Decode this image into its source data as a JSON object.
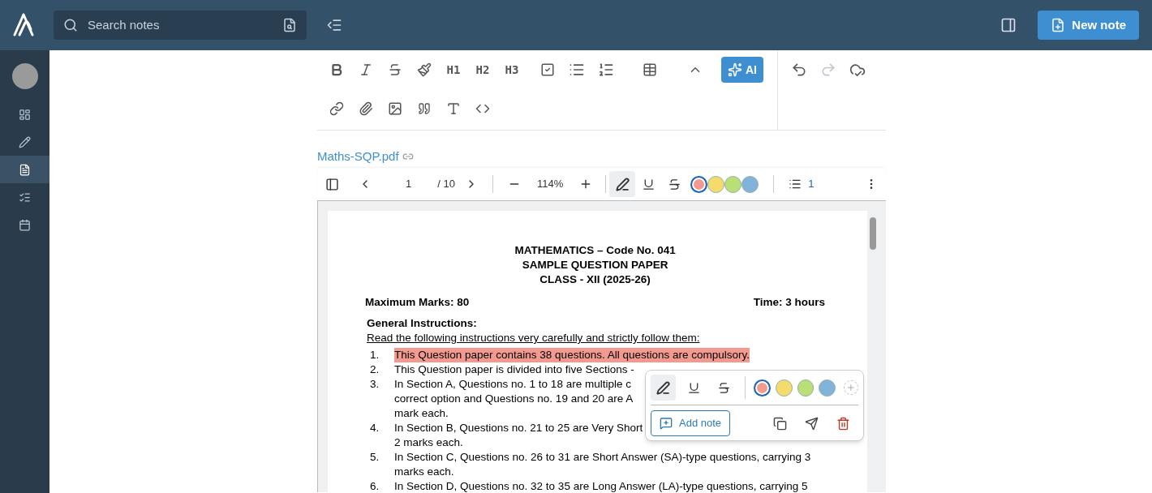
{
  "topbar": {
    "search": {
      "placeholder": "Search notes"
    },
    "new_note": "New note"
  },
  "sidebar": {
    "items": [
      {
        "kind": "dashboard",
        "selected": false
      },
      {
        "kind": "edit",
        "selected": false
      },
      {
        "kind": "document",
        "selected": true
      },
      {
        "kind": "tasks",
        "selected": false
      },
      {
        "kind": "calendar",
        "selected": false
      }
    ]
  },
  "editor_toolbar": {
    "headings": [
      "H1",
      "H2",
      "H3"
    ],
    "ai": "AI"
  },
  "attachment": {
    "name": "Maths-SQP.pdf"
  },
  "pdf_toolbar": {
    "page": "1",
    "total": "/ 10",
    "zoom": "114%",
    "tools": [
      {
        "kind": "highlight",
        "selected": true
      },
      {
        "kind": "underline",
        "selected": false
      },
      {
        "kind": "strike",
        "selected": false
      }
    ],
    "colors": [
      {
        "color": "#f29a8f",
        "selected": true
      },
      {
        "color": "#f3dc6b",
        "selected": false
      },
      {
        "color": "#b9df77",
        "selected": false
      },
      {
        "color": "#7fb3da",
        "selected": false
      }
    ],
    "annotations": "1"
  },
  "document": {
    "title_lines": [
      "MATHEMATICS – Code No. 041",
      "SAMPLE QUESTION PAPER",
      "CLASS - XII (2025-26)"
    ],
    "max_marks": "Maximum Marks: 80",
    "time": "Time: 3 hours",
    "heading": "General Instructions:",
    "intro": "Read the following instructions very carefully and strictly follow them:",
    "items": [
      {
        "number": "1.",
        "highlighted": true,
        "lines": [
          "This Question paper contains 38 questions. All questions are compulsory."
        ]
      },
      {
        "number": "2.",
        "highlighted": false,
        "lines": [
          "This Question paper is divided into five Sections -"
        ]
      },
      {
        "number": "3.",
        "highlighted": false,
        "lines": [
          "In Section A, Questions no. 1 to 18 are multiple c",
          "correct option and Questions no. 19 and 20 are A",
          "mark each."
        ]
      },
      {
        "number": "4.",
        "highlighted": false,
        "lines": [
          "In Section B, Questions no. 21 to 25 are Very Short",
          "2 marks each."
        ]
      },
      {
        "number": "5.",
        "highlighted": false,
        "lines": [
          "In Section C, Questions no. 26 to 31 are Short Answer (SA)-type questions, carrying 3",
          "marks each."
        ]
      },
      {
        "number": "6.",
        "highlighted": false,
        "lines": [
          "In Section D, Questions no. 32 to 35 are Long Answer (LA)-type questions, carrying 5"
        ]
      }
    ]
  },
  "popup": {
    "tools": [
      {
        "kind": "highlight",
        "selected": true
      },
      {
        "kind": "underline",
        "selected": false
      },
      {
        "kind": "strike",
        "selected": false
      }
    ],
    "colors": [
      {
        "color": "#f29a8f",
        "selected": true
      },
      {
        "color": "#f3dc6b",
        "selected": false
      },
      {
        "color": "#b9df77",
        "selected": false
      },
      {
        "color": "#7fb3da",
        "selected": false
      }
    ],
    "add_note": "Add note"
  }
}
